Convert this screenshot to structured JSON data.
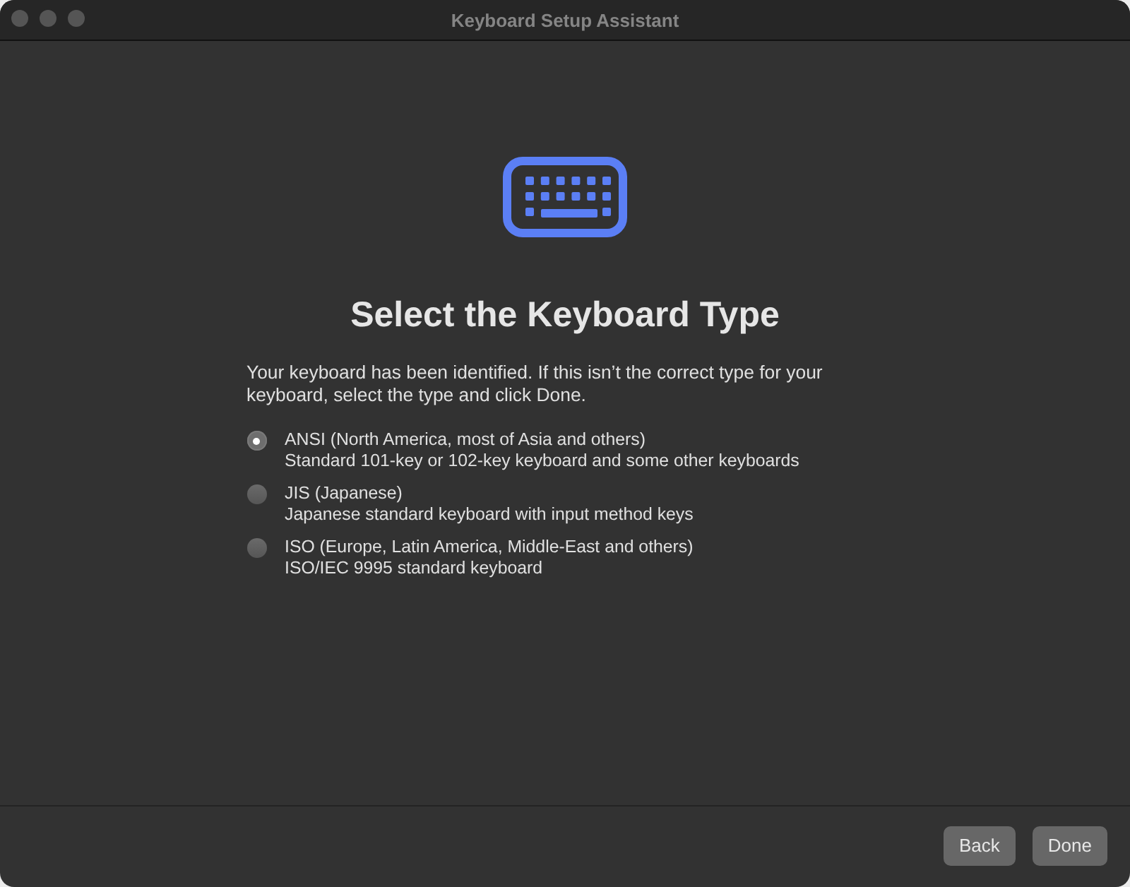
{
  "window": {
    "title": "Keyboard Setup Assistant"
  },
  "heading": "Select the Keyboard Type",
  "description": "Your keyboard has been identified. If this isn’t the correct type for your keyboard, select the type and click Done.",
  "options": [
    {
      "label": "ANSI (North America, most of Asia and others)",
      "detail": "Standard 101-key or 102-key keyboard and some other keyboards",
      "selected": true
    },
    {
      "label": "JIS (Japanese)",
      "detail": "Japanese standard keyboard with input method keys",
      "selected": false
    },
    {
      "label": "ISO (Europe, Latin America, Middle-East and others)",
      "detail": "ISO/IEC 9995 standard keyboard",
      "selected": false
    }
  ],
  "buttons": [
    {
      "label": "Back"
    },
    {
      "label": "Done"
    }
  ]
}
